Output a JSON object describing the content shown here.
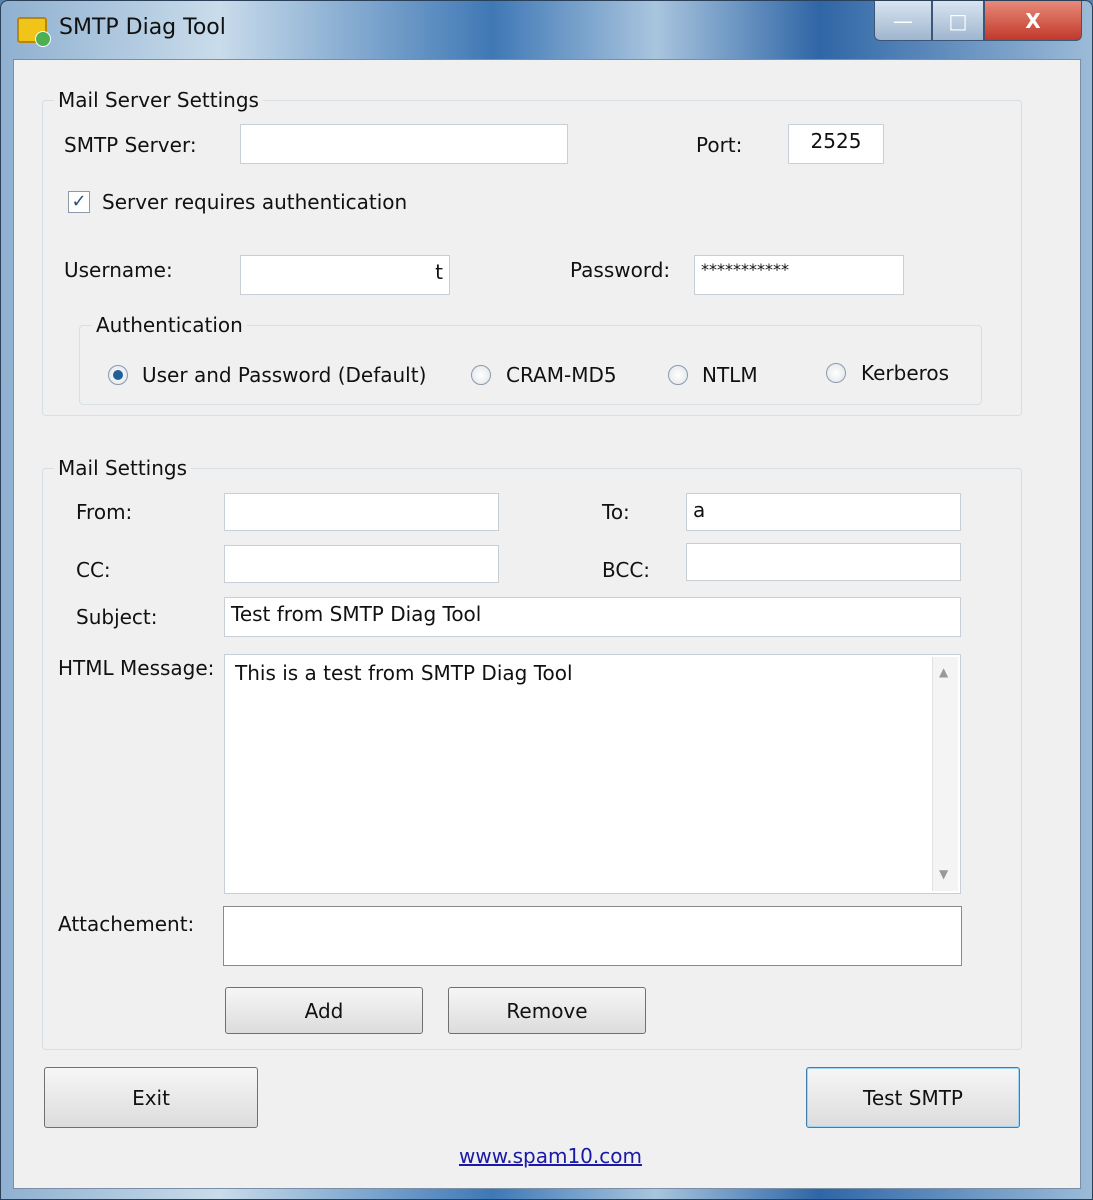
{
  "window": {
    "title": "SMTP Diag Tool",
    "minimize": "—",
    "maximize": "□",
    "close": "X"
  },
  "server": {
    "group_label": "Mail Server Settings",
    "smtp_label": "SMTP Server:",
    "smtp_value": "",
    "port_label": "Port:",
    "port_value": "2525",
    "auth_checkbox_label": "Server requires authentication",
    "auth_checked": true,
    "username_label": "Username:",
    "username_value": "t",
    "password_label": "Password:",
    "password_value": "***********"
  },
  "authentication": {
    "group_label": "Authentication",
    "options": [
      {
        "label": "User and Password (Default)",
        "selected": true
      },
      {
        "label": "CRAM-MD5",
        "selected": false
      },
      {
        "label": "NTLM",
        "selected": false
      },
      {
        "label": "Kerberos",
        "selected": false
      }
    ]
  },
  "mail": {
    "group_label": "Mail Settings",
    "from_label": "From:",
    "from_value": "",
    "to_label": "To:",
    "to_value": "a",
    "cc_label": "CC:",
    "cc_value": "",
    "bcc_label": "BCC:",
    "bcc_value": "",
    "subject_label": "Subject:",
    "subject_value": "Test from SMTP Diag Tool",
    "message_label": "HTML Message:",
    "message_value": "This is a test from SMTP Diag Tool",
    "attachment_label": "Attachement:",
    "add_label": "Add",
    "remove_label": "Remove"
  },
  "footer": {
    "exit_label": "Exit",
    "test_label": "Test SMTP",
    "link": "www.spam10.com"
  }
}
